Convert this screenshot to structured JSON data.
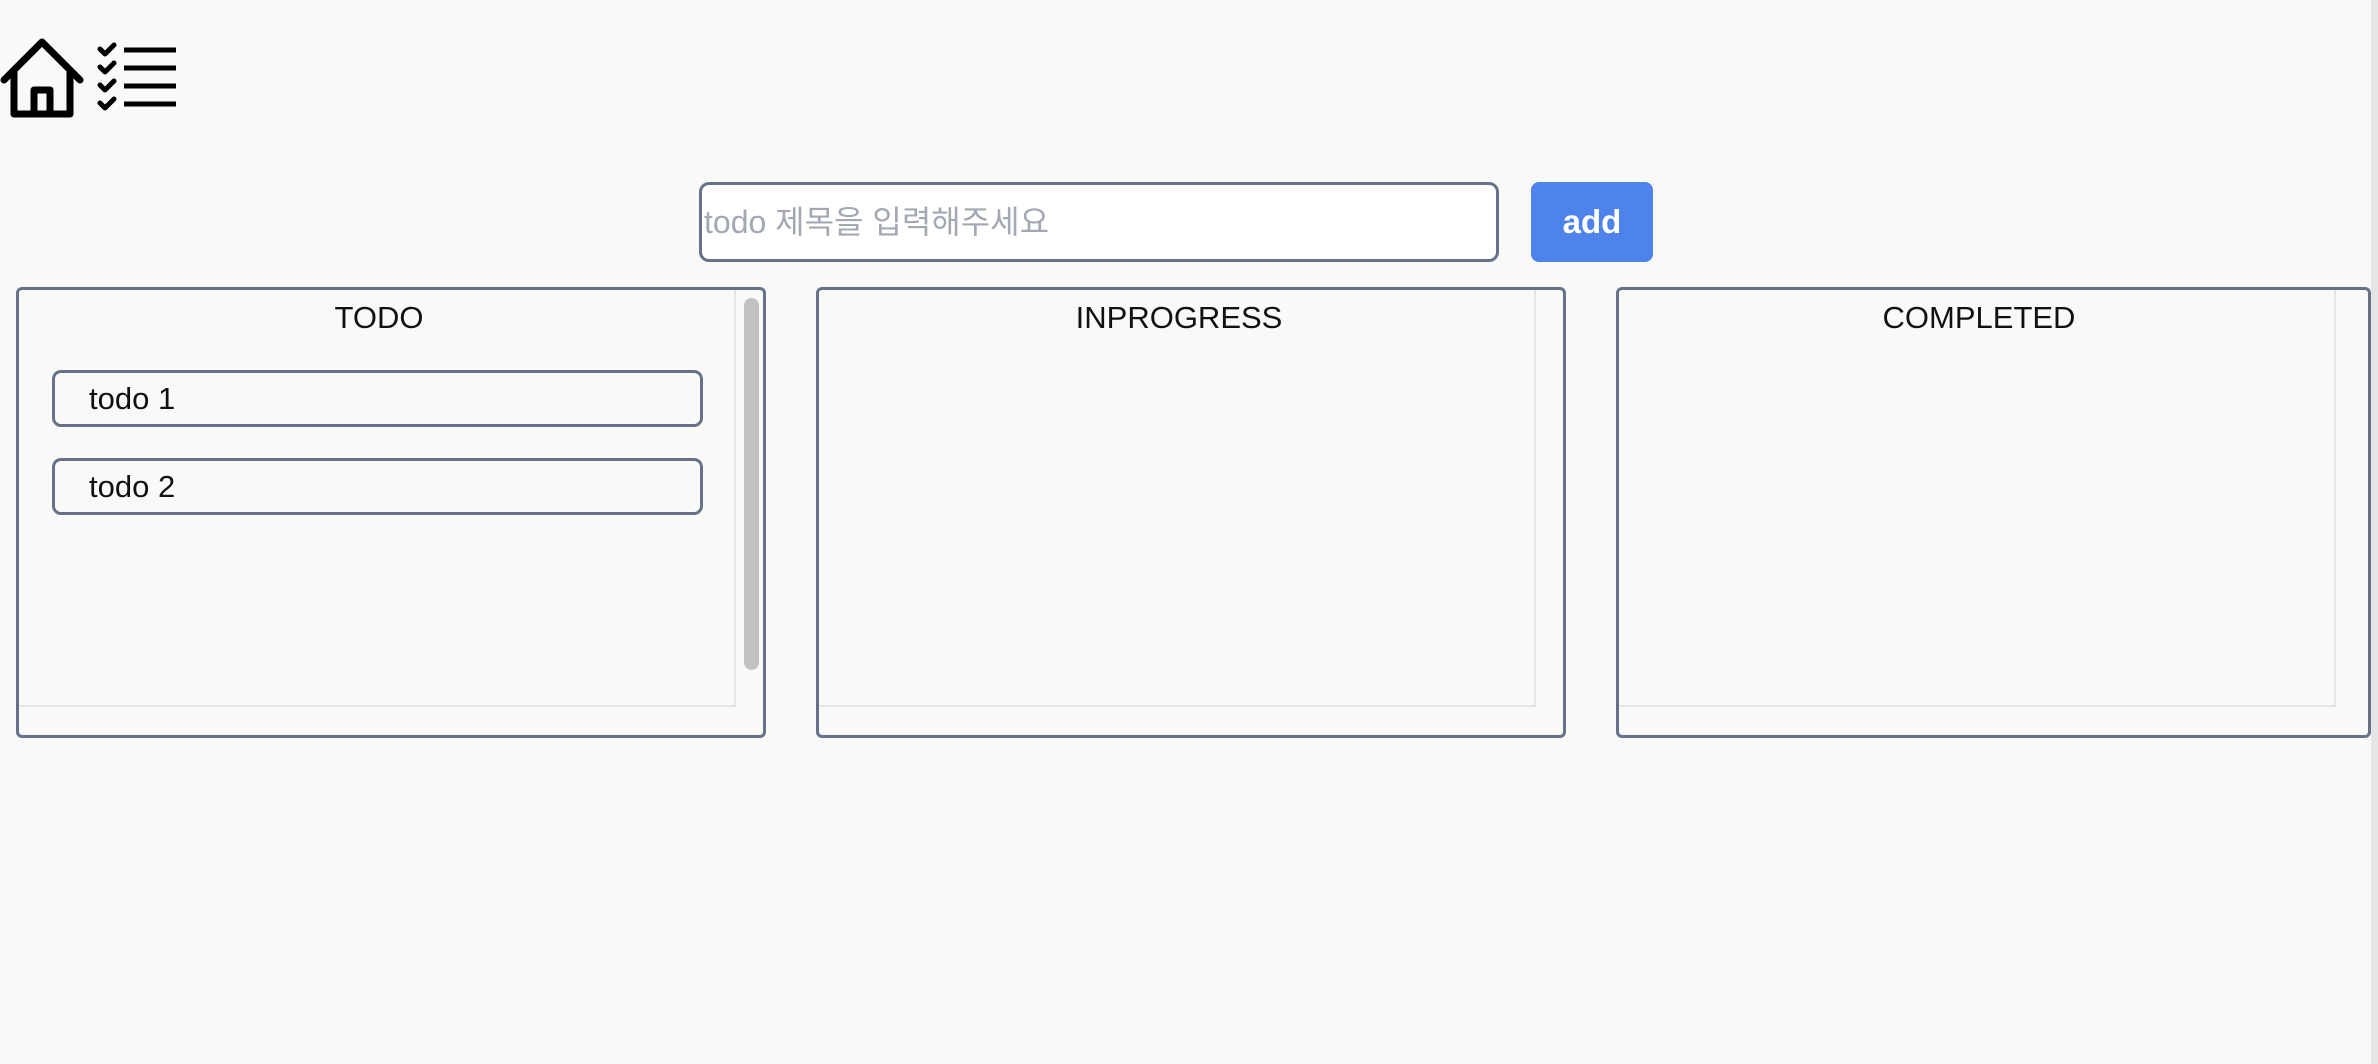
{
  "nav": {
    "home_icon": "home-icon",
    "list_icon": "checklist-icon"
  },
  "form": {
    "placeholder": "todo 제목을 입력해주세요",
    "value": "",
    "add_label": "add"
  },
  "columns": [
    {
      "title": "TODO",
      "items": [
        "todo 1",
        "todo 2"
      ]
    },
    {
      "title": "INPROGRESS",
      "items": []
    },
    {
      "title": "COMPLETED",
      "items": []
    }
  ],
  "colors": {
    "accent": "#4f83ec",
    "border": "#66728a",
    "background": "#f9f9f8"
  }
}
